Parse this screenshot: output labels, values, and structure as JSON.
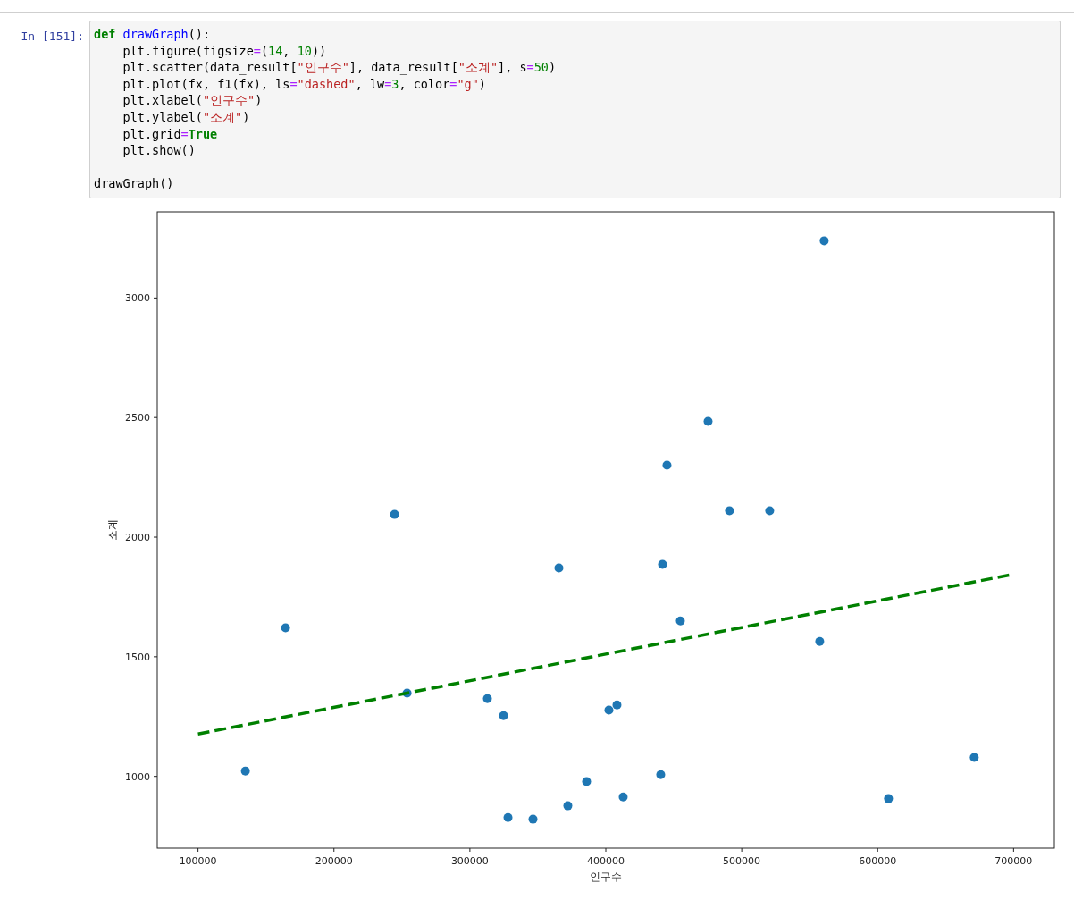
{
  "cell": {
    "prompt": "In [151]:",
    "code_lines": [
      {
        "tokens": [
          {
            "t": "def ",
            "kind": "keyword"
          },
          {
            "t": "drawGraph",
            "kind": "def"
          },
          {
            "t": "():",
            "kind": "plain"
          }
        ]
      },
      {
        "tokens": [
          {
            "t": "    plt.figure(figsize",
            "kind": "plain"
          },
          {
            "t": "=",
            "kind": "op"
          },
          {
            "t": "(",
            "kind": "plain"
          },
          {
            "t": "14",
            "kind": "number"
          },
          {
            "t": ", ",
            "kind": "plain"
          },
          {
            "t": "10",
            "kind": "number"
          },
          {
            "t": "))",
            "kind": "plain"
          }
        ]
      },
      {
        "tokens": [
          {
            "t": "    plt.scatter(data_result[",
            "kind": "plain"
          },
          {
            "t": "\"인구수\"",
            "kind": "string"
          },
          {
            "t": "], data_result[",
            "kind": "plain"
          },
          {
            "t": "\"소계\"",
            "kind": "string"
          },
          {
            "t": "], s",
            "kind": "plain"
          },
          {
            "t": "=",
            "kind": "op"
          },
          {
            "t": "50",
            "kind": "number"
          },
          {
            "t": ")",
            "kind": "plain"
          }
        ]
      },
      {
        "tokens": [
          {
            "t": "    plt.plot(fx, f1(fx), ls",
            "kind": "plain"
          },
          {
            "t": "=",
            "kind": "op"
          },
          {
            "t": "\"dashed\"",
            "kind": "string"
          },
          {
            "t": ", lw",
            "kind": "plain"
          },
          {
            "t": "=",
            "kind": "op"
          },
          {
            "t": "3",
            "kind": "number"
          },
          {
            "t": ", color",
            "kind": "plain"
          },
          {
            "t": "=",
            "kind": "op"
          },
          {
            "t": "\"g\"",
            "kind": "string"
          },
          {
            "t": ")",
            "kind": "plain"
          }
        ]
      },
      {
        "tokens": [
          {
            "t": "    plt.xlabel(",
            "kind": "plain"
          },
          {
            "t": "\"인구수\"",
            "kind": "string"
          },
          {
            "t": ")",
            "kind": "plain"
          }
        ]
      },
      {
        "tokens": [
          {
            "t": "    plt.ylabel(",
            "kind": "plain"
          },
          {
            "t": "\"소계\"",
            "kind": "string"
          },
          {
            "t": ")",
            "kind": "plain"
          }
        ]
      },
      {
        "tokens": [
          {
            "t": "    plt.grid",
            "kind": "plain"
          },
          {
            "t": "=",
            "kind": "op"
          },
          {
            "t": "True",
            "kind": "keyword"
          }
        ]
      },
      {
        "tokens": [
          {
            "t": "    plt.show()",
            "kind": "plain"
          }
        ]
      },
      {
        "gap_before": true,
        "tokens": [
          {
            "t": "drawGraph()",
            "kind": "plain"
          }
        ]
      }
    ]
  },
  "output": {
    "chart_data": {
      "type": "scatter",
      "xlabel": "인구수",
      "ylabel": "소계",
      "xlim": [
        70000,
        730000
      ],
      "ylim": [
        700,
        3360
      ],
      "xticks": [
        100000,
        200000,
        300000,
        400000,
        500000,
        600000,
        700000
      ],
      "yticks": [
        1000,
        1500,
        2000,
        2500,
        3000
      ],
      "series": [
        {
          "type": "scatter",
          "color": "#1f77b4",
          "x": [
            134830,
            164400,
            244580,
            253780,
            312900,
            324750,
            328030,
            346430,
            365490,
            372060,
            385860,
            402290,
            408200,
            412800,
            440400,
            441720,
            445000,
            454860,
            475240,
            491010,
            520580,
            557380,
            560660,
            607980,
            671060
          ],
          "values": [
            1022,
            1621,
            2095,
            1348,
            1325,
            1254,
            828,
            821,
            1871,
            877,
            978,
            1277,
            1299,
            914,
            1007,
            1886,
            2301,
            1650,
            2484,
            2110,
            2110,
            1564,
            3239,
            907,
            1079
          ]
        },
        {
          "type": "line",
          "line_style": "dashed",
          "color": "#008000",
          "x": [
            100000,
            700000
          ],
          "values": [
            1177,
            1845
          ]
        }
      ]
    }
  }
}
